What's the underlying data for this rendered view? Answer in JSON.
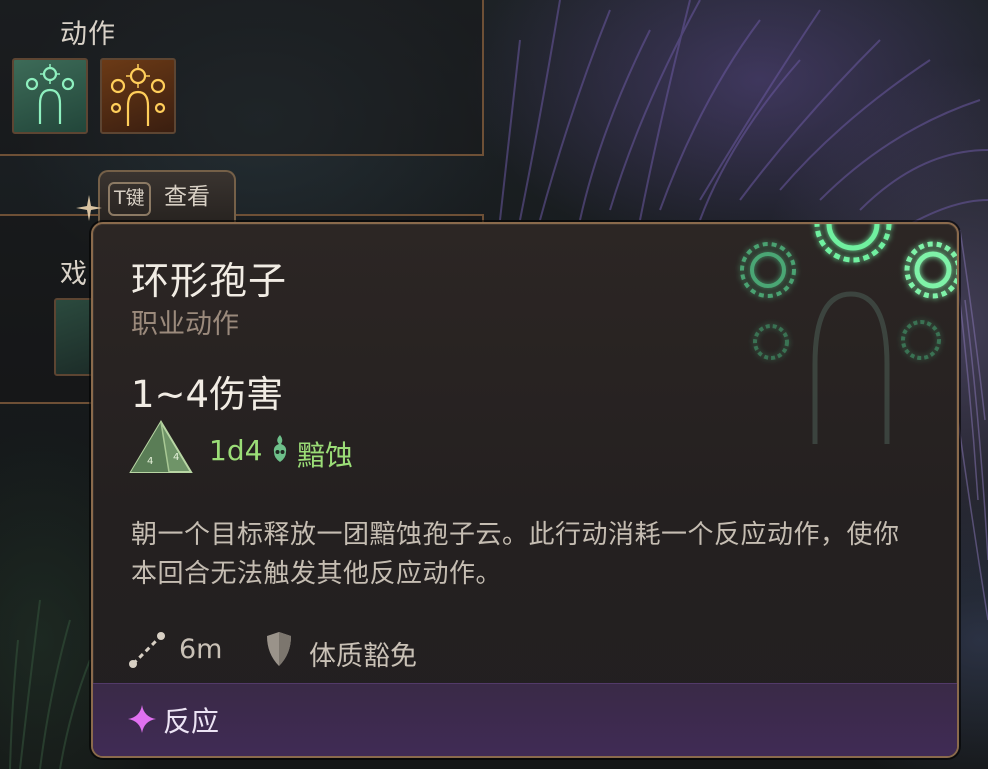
{
  "hotbar": {
    "actions_title": "动作",
    "second_title": "戏",
    "slots": [
      {
        "icon": "circle-of-spores-icon",
        "accent": "#5fd59a"
      },
      {
        "icon": "radiant-spores-icon",
        "accent": "#f0b030"
      }
    ],
    "tkey": {
      "key": "T键",
      "label": "查看"
    }
  },
  "tooltip": {
    "name": "环形孢子",
    "type": "职业动作",
    "damage": "1~4伤害",
    "dice": {
      "value": "1d4",
      "damage_type": "黯蚀",
      "color": "#9bdd77",
      "icon": "d4-dice-icon"
    },
    "description": "朝一个目标释放一团黯蚀孢子云。此行动消耗一个反应动作，使你本回合无法触发其他反应动作。",
    "range": "6m",
    "saving_throw": "体质豁免",
    "footer": {
      "label": "反应",
      "accent": "#e070f0"
    },
    "art_icon": "spores-silhouette-icon"
  }
}
